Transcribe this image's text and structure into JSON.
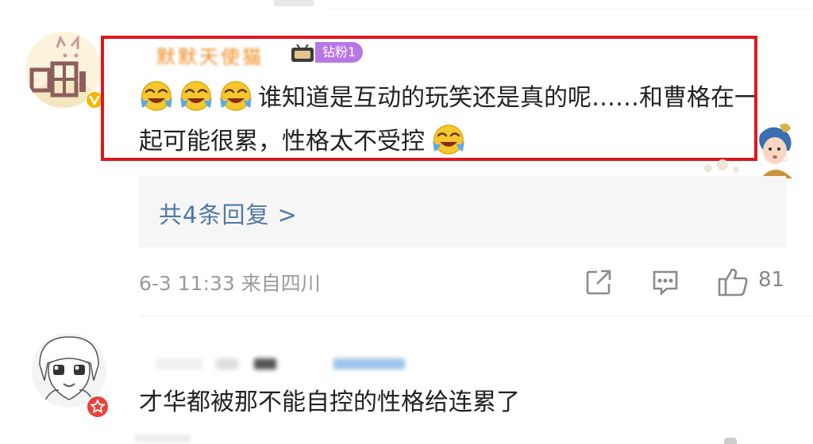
{
  "comment1": {
    "username": "默默天使猫",
    "fan_badge": "钻粉1",
    "emoji_icon": "laughing-crying-emoji",
    "text_a": "谁知道是互动的玩笑还是真的呢……和曹格在一起可能很累，性格太不受控",
    "reply_link": "共4条回复 >",
    "timestamp": "6-3 11:33",
    "location": "来自四川",
    "like_count": "81",
    "highlight_color": "#e0161d"
  },
  "comment2": {
    "text": "才华都被那不能自控的性格给连累了"
  },
  "colors": {
    "link": "#4e78a4",
    "fan_badge_bg": "#b777e6",
    "username": "#f08a1c"
  }
}
